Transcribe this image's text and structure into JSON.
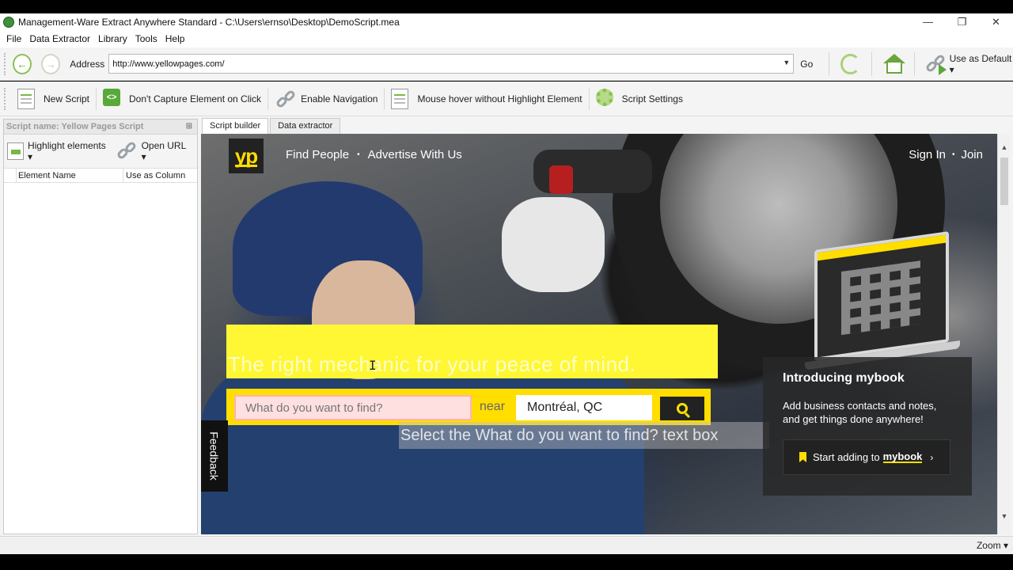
{
  "window": {
    "title": "Management-Ware Extract Anywhere Standard - C:\\Users\\ernso\\Desktop\\DemoScript.mea",
    "minimize": "—",
    "restore": "❐",
    "close": "✕"
  },
  "menu": [
    "File",
    "Data Extractor",
    "Library",
    "Tools",
    "Help"
  ],
  "nav": {
    "address_label": "Address",
    "address_value": "http://www.yellowpages.com/",
    "go_label": "Go",
    "use_default_label": "Use as Default ▾"
  },
  "toolbar": {
    "new_script": "New Script",
    "dont_capture": "Don't Capture Element on Click",
    "enable_navigation": "Enable Navigation",
    "mouse_hover": "Mouse hover without Highlight Element",
    "script_settings": "Script Settings"
  },
  "left_panel": {
    "header": "Script name: Yellow Pages Script",
    "highlight_elements": "Highlight elements ▾",
    "open_url": "Open URL ▾",
    "columns": [
      "Element Name",
      "Use as Column"
    ]
  },
  "tabs": [
    "Script builder",
    "Data extractor"
  ],
  "site": {
    "logo": "yp",
    "nav": [
      "Find People",
      "Advertise With Us"
    ],
    "sign_in": "Sign In",
    "join": "Join",
    "headline": "The right mechanic for your peace of mind.",
    "search_placeholder": "What do you want to find?",
    "near": "near",
    "location": "Montréal, QC",
    "tooltip": "Select the What do you want to find? text box",
    "feedback": "Feedback",
    "mybook": {
      "title": "Introducing mybook",
      "desc": "Add business contacts and notes, and get things done anywhere!",
      "cta_prefix": "Start adding to",
      "cta_brand": "mybook",
      "cta_chevron": "›"
    }
  },
  "status": {
    "zoom": "Zoom ▾"
  },
  "colors": {
    "accent_green": "#6aa63a",
    "yp_yellow": "#ffde00",
    "highlight_yellow": "#fff733"
  }
}
